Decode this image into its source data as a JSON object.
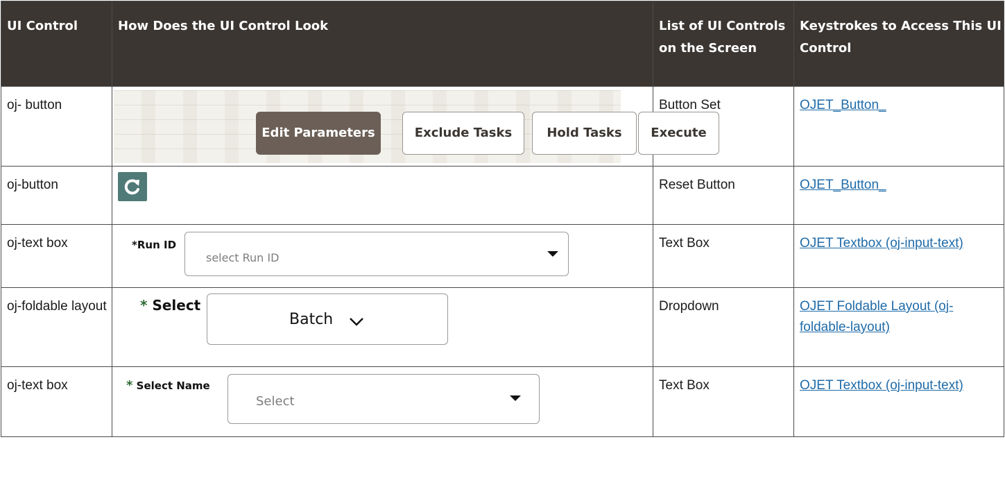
{
  "table": {
    "headers": [
      "UI Control",
      "How Does the UI Control Look",
      "List of UI Controls on the Screen",
      "Keystrokes to Access This UI Control"
    ],
    "rows": [
      {
        "control": "oj- button",
        "list": "Button Set",
        "link": "OJET_Button_"
      },
      {
        "control": "oj-button",
        "list": "Reset Button",
        "link": "OJET_Button_"
      },
      {
        "control": "oj-text box",
        "list": "Text Box",
        "link": "OJET Textbox (oj-input-text)"
      },
      {
        "control": "oj-foldable layout",
        "list": "Dropdown",
        "link": "OJET Foldable Layout (oj-foldable-layout)"
      },
      {
        "control": "oj-text box",
        "list": "Text Box",
        "link": "OJET Textbox (oj-input-text)"
      }
    ]
  },
  "button_set": {
    "buttons": [
      "Edit Parameters",
      "Exclude Tasks",
      "Hold Tasks",
      "Execute"
    ]
  },
  "reset": {
    "icon": "refresh-icon"
  },
  "run_id": {
    "required": "*",
    "label": "Run ID",
    "placeholder": "select Run ID"
  },
  "foldable": {
    "required": "*",
    "label": "Select",
    "value": "Batch"
  },
  "select_name": {
    "required": "*",
    "label": "Select Name",
    "placeholder": "Select"
  },
  "colors": {
    "header_bg": "#3b3632",
    "primary_button": "#6b5f57",
    "reset_bg": "#4f7a77",
    "link": "#1f6ba8",
    "required_mark": "#2e6b35"
  }
}
